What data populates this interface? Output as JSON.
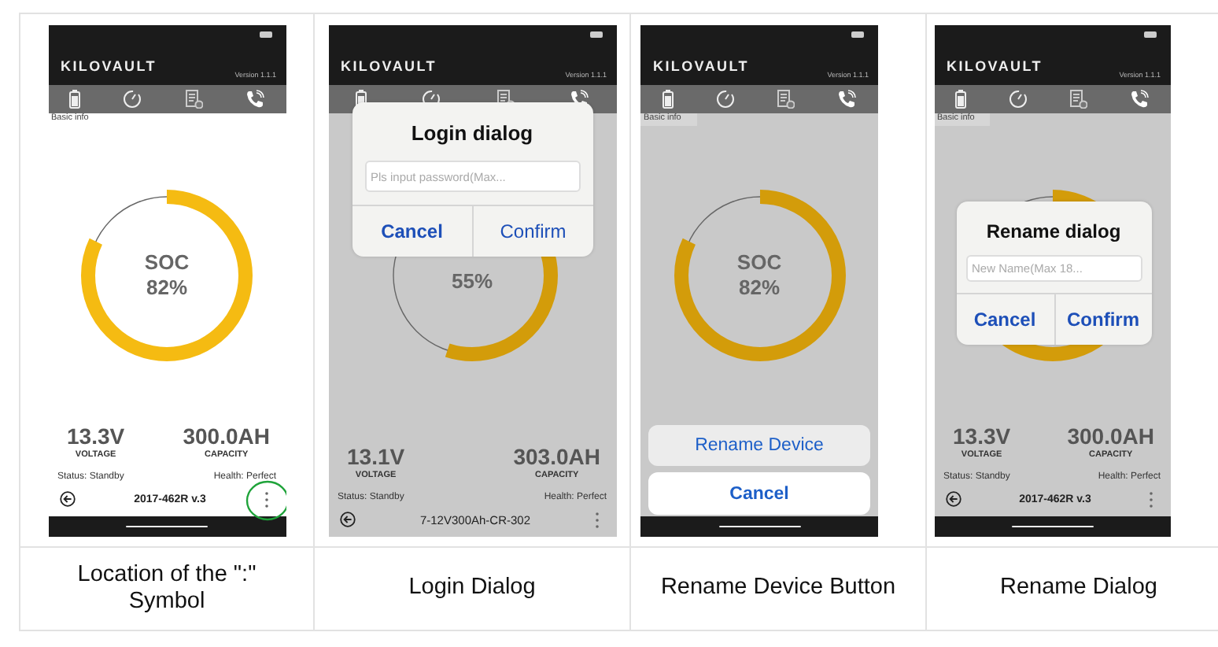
{
  "panels": [
    {
      "dimmed": false,
      "logo": "KILOVAULT",
      "version": "Version 1.1.1",
      "tab_label": "Basic info",
      "gauge": {
        "label": "SOC",
        "value": "82%",
        "level": 0.82
      },
      "readings": [
        {
          "value": "13.3V",
          "label": "VOLTAGE"
        },
        {
          "value": "300.0AH",
          "label": "CAPACITY"
        }
      ],
      "status": "Status: Standby",
      "health": "Health: Perfect",
      "device": "2017-462R v.3",
      "menu_highlighted": true,
      "home_bar": true,
      "caption": "Location of the \":\" Symbol"
    },
    {
      "dimmed": true,
      "logo": "KILOVAULT",
      "version": "Version 1.1.1",
      "gauge": {
        "value": "55%"
      },
      "readings": [
        {
          "value": "13.1V",
          "label": "VOLTAGE"
        },
        {
          "value": "303.0AH",
          "label": "CAPACITY"
        }
      ],
      "status": "Status: Standby",
      "health": "Health: Perfect",
      "device": "7-12V300Ah-CR-302",
      "overlay": {
        "kind": "dialog",
        "title": "Login dialog",
        "placeholder": "Pls input password(Max...",
        "buttons": [
          {
            "label": "Cancel",
            "bold": true
          },
          {
            "label": "Confirm",
            "bold": false
          }
        ]
      },
      "caption": "Login Dialog"
    },
    {
      "dimmed": true,
      "logo": "KILOVAULT",
      "version": "Version 1.1.1",
      "tab_label": "Basic info",
      "gauge": {
        "label": "SOC",
        "value": "82%",
        "level": 0.82
      },
      "home_bar": true,
      "overlay": {
        "kind": "action_sheet",
        "action": "Rename Device",
        "cancel": "Cancel"
      },
      "caption": "Rename Device Button"
    },
    {
      "dimmed": true,
      "logo": "KILOVAULT",
      "version": "Version 1.1.1",
      "tab_label": "Basic info",
      "readings": [
        {
          "value": "13.3V",
          "label": "VOLTAGE"
        },
        {
          "value": "300.0AH",
          "label": "CAPACITY"
        }
      ],
      "status": "Status: Standby",
      "health": "Health: Perfect",
      "device": "2017-462R v.3",
      "home_bar": true,
      "overlay": {
        "kind": "dialog",
        "title": "Rename dialog",
        "placeholder": "New Name(Max 18...",
        "buttons": [
          {
            "label": "Cancel",
            "bold": true
          },
          {
            "label": "Confirm",
            "bold": true
          }
        ]
      },
      "caption": "Rename Dialog"
    }
  ]
}
